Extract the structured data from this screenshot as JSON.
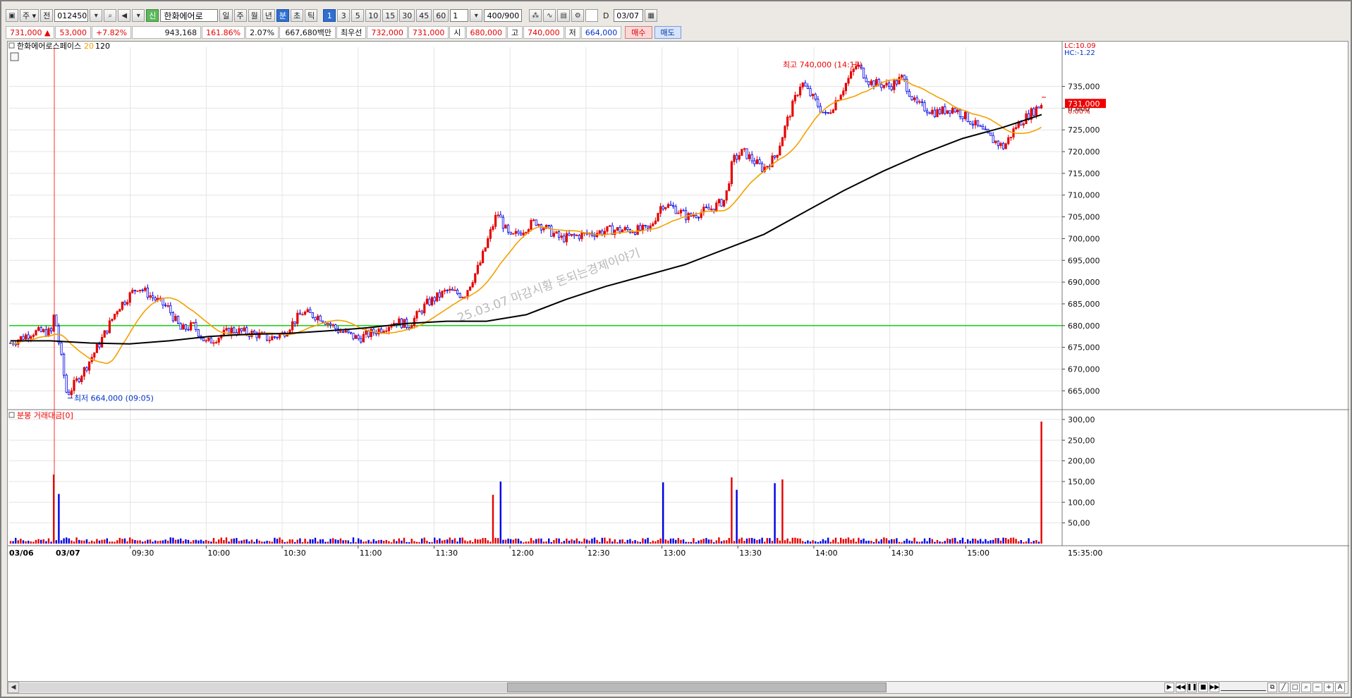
{
  "toolbar": {
    "period_selector": "주",
    "market_label": "전",
    "stock_code": "012450",
    "stock_name": "한화에어로",
    "new_badge": "신",
    "period_tabs": [
      "일",
      "주",
      "월",
      "년",
      "분",
      "초",
      "틱"
    ],
    "active_period": "분",
    "interval_buttons": [
      "1",
      "3",
      "5",
      "10",
      "15",
      "30",
      "45",
      "60"
    ],
    "active_interval": "1",
    "interval_value": "1",
    "count": "400/900",
    "date_label": "D",
    "date": "03/07"
  },
  "quote": {
    "price": "731,000",
    "change_sign": "▲",
    "change": "53,000",
    "change_pct": "+7.82%",
    "volume": "943,168",
    "volume_ratio": "161.86%",
    "turnover_ratio": "2.07%",
    "amount": "667,680백만",
    "best_label": "최우선",
    "best_ask": "732,000",
    "best_bid": "731,000",
    "open_label": "시",
    "open": "680,000",
    "high_label": "고",
    "high": "740,000",
    "low_label": "저",
    "low": "664,000",
    "buy_label": "매수",
    "sell_label": "매도"
  },
  "price_pane": {
    "legend_name": "한화에어로스페이스",
    "ma20_label": "20",
    "ma120_label": "120",
    "lc_label": "LC:10.09",
    "hc_label": "HC:-1.22",
    "last_price_tag": "731,000",
    "last_pct_tag": "0.00%",
    "high_annotation": "최고 740,000 (14:17)",
    "low_annotation": "최저 664,000 (09:05)",
    "watermark": "25.03.07 마감시황 돈되는경제이야기",
    "ref_line_price": 680000,
    "colors": {
      "up": "#e60000",
      "down": "#0000e6",
      "ma20": "#f5a000",
      "ma120": "#000000",
      "ref": "#00cc00"
    }
  },
  "volume_pane": {
    "legend": "분봉 거래대금[0]"
  },
  "axis": {
    "time_start": "03/06",
    "session_start": "03/07",
    "end_time": "15:35:00"
  },
  "chart_data": {
    "type": "candlestick",
    "price_axis": {
      "ylim": [
        661000,
        744000
      ],
      "ticks": [
        665000,
        670000,
        675000,
        680000,
        685000,
        690000,
        695000,
        700000,
        705000,
        710000,
        715000,
        720000,
        725000,
        730000,
        735000
      ],
      "tick_labels": [
        "665,000",
        "670,000",
        "675,000",
        "680,000",
        "685,000",
        "690,000",
        "695,000",
        "700,000",
        "705,000",
        "710,000",
        "715,000",
        "720,000",
        "725,000",
        "0,000",
        "735,000"
      ]
    },
    "volume_axis": {
      "ylim": [
        0,
        305
      ],
      "ticks": [
        50,
        100,
        150,
        200,
        250,
        300
      ],
      "tick_labels": [
        "50,00",
        "100,00",
        "150,00",
        "200,00",
        "250,00",
        "300,00"
      ]
    },
    "time_axis": {
      "labels": [
        "09:30",
        "10:00",
        "10:30",
        "11:00",
        "11:30",
        "12:00",
        "12:30",
        "13:00",
        "13:30",
        "14:00",
        "14:30",
        "15:00"
      ]
    },
    "price_path": [
      {
        "t": "03/06",
        "p": 676000
      },
      {
        "t": "prev",
        "p": 678500
      },
      {
        "t": "prev-close",
        "p": 678500
      },
      {
        "t": "09:00",
        "p": 683000
      },
      {
        "t": "09:05",
        "p": 664000
      },
      {
        "t": "09:12",
        "p": 670000
      },
      {
        "t": "09:18",
        "p": 676000
      },
      {
        "t": "09:25",
        "p": 684000
      },
      {
        "t": "09:33",
        "p": 689000
      },
      {
        "t": "09:40",
        "p": 686000
      },
      {
        "t": "09:45",
        "p": 684000
      },
      {
        "t": "09:50",
        "p": 679000
      },
      {
        "t": "09:55",
        "p": 680000
      },
      {
        "t": "10:00",
        "p": 676000
      },
      {
        "t": "10:10",
        "p": 679000
      },
      {
        "t": "10:20",
        "p": 678000
      },
      {
        "t": "10:25",
        "p": 677000
      },
      {
        "t": "10:30",
        "p": 678000
      },
      {
        "t": "10:38",
        "p": 683000
      },
      {
        "t": "10:45",
        "p": 682000
      },
      {
        "t": "10:52",
        "p": 679000
      },
      {
        "t": "11:00",
        "p": 677000
      },
      {
        "t": "11:08",
        "p": 679000
      },
      {
        "t": "11:15",
        "p": 681000
      },
      {
        "t": "11:20",
        "p": 680000
      },
      {
        "t": "11:27",
        "p": 685000
      },
      {
        "t": "11:35",
        "p": 688000
      },
      {
        "t": "11:42",
        "p": 687000
      },
      {
        "t": "11:48",
        "p": 694000
      },
      {
        "t": "11:52",
        "p": 701000
      },
      {
        "t": "11:55",
        "p": 706000
      },
      {
        "t": "12:00",
        "p": 700000
      },
      {
        "t": "12:10",
        "p": 704000
      },
      {
        "t": "12:20",
        "p": 700000
      },
      {
        "t": "12:30",
        "p": 701000
      },
      {
        "t": "12:40",
        "p": 702000
      },
      {
        "t": "12:55",
        "p": 702000
      },
      {
        "t": "13:00",
        "p": 708000
      },
      {
        "t": "13:05",
        "p": 707000
      },
      {
        "t": "13:10",
        "p": 705000
      },
      {
        "t": "13:20",
        "p": 707000
      },
      {
        "t": "13:25",
        "p": 709000
      },
      {
        "t": "13:28",
        "p": 718000
      },
      {
        "t": "13:32",
        "p": 720000
      },
      {
        "t": "13:40",
        "p": 716000
      },
      {
        "t": "13:45",
        "p": 719000
      },
      {
        "t": "13:50",
        "p": 728000
      },
      {
        "t": "13:55",
        "p": 736000
      },
      {
        "t": "14:00",
        "p": 732000
      },
      {
        "t": "14:05",
        "p": 728000
      },
      {
        "t": "14:10",
        "p": 733000
      },
      {
        "t": "14:17",
        "p": 740000
      },
      {
        "t": "14:22",
        "p": 736000
      },
      {
        "t": "14:30",
        "p": 735000
      },
      {
        "t": "14:35",
        "p": 737000
      },
      {
        "t": "14:40",
        "p": 731000
      },
      {
        "t": "14:48",
        "p": 729000
      },
      {
        "t": "14:55",
        "p": 730000
      },
      {
        "t": "15:00",
        "p": 728000
      },
      {
        "t": "15:10",
        "p": 723000
      },
      {
        "t": "15:15",
        "p": 721000
      },
      {
        "t": "15:20",
        "p": 726000
      },
      {
        "t": "15:30",
        "p": 731000
      }
    ],
    "ma120_path": [
      676500,
      676500,
      676000,
      675800,
      676500,
      677500,
      678000,
      678200,
      678800,
      679500,
      680500,
      681000,
      681000,
      682500,
      686000,
      689000,
      691500,
      694000,
      697500,
      701000,
      706000,
      711000,
      715500,
      719500,
      723000,
      725500,
      728500
    ],
    "volume_spikes": [
      {
        "t": "09:00",
        "v": 167
      },
      {
        "t": "09:02",
        "v": 120
      },
      {
        "t": "11:53",
        "v": 118
      },
      {
        "t": "11:56",
        "v": 150
      },
      {
        "t": "13:00",
        "v": 148
      },
      {
        "t": "13:28",
        "v": 160
      },
      {
        "t": "13:30",
        "v": 130
      },
      {
        "t": "13:45",
        "v": 146
      },
      {
        "t": "13:48",
        "v": 155
      },
      {
        "t": "15:30",
        "v": 295
      }
    ]
  }
}
